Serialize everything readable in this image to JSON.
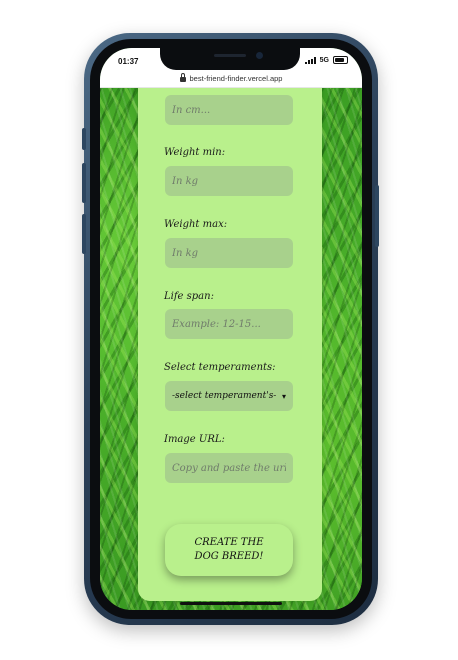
{
  "status_bar": {
    "time": "01:37",
    "network": "5G"
  },
  "browser": {
    "url": "best-friend-finder.vercel.app"
  },
  "form": {
    "height_placeholder": "In cm...",
    "weight_min_label": "Weight min:",
    "weight_min_placeholder": "In kg",
    "weight_max_label": "Weight max:",
    "weight_max_placeholder": "In kg",
    "life_span_label": "Life span:",
    "life_span_placeholder": "Example: 12-15...",
    "temperaments_label": "Select temperaments:",
    "temperaments_selected": "-select temperament's-",
    "image_url_label": "Image URL:",
    "image_url_placeholder": "Copy and paste the url here",
    "submit_label": "CREATE THE DOG BREED!"
  },
  "colors": {
    "panel": "#b9f08c",
    "input": "#a8d18c",
    "grass": "#3b9e23",
    "phone_frame": "#2b4058"
  },
  "icons": {
    "lock": "lock-icon",
    "select": "chevron-down-icon"
  }
}
